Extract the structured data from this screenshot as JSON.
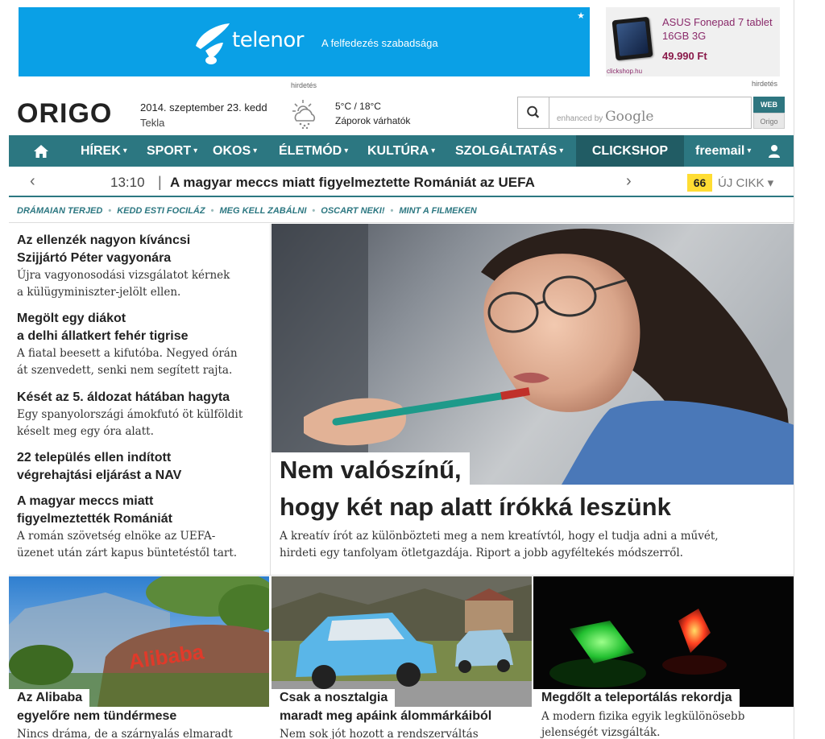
{
  "ads": {
    "banner_brand": "telenor",
    "banner_slogan": "A felfedezés szabadsága",
    "banner_star": "★",
    "ad_label": "hirdetés",
    "side_product": "ASUS Fonepad 7 tablet 16GB 3G",
    "side_price": "49.990 Ft",
    "side_shop": "clickshop.hu",
    "side_label": "hirdetés",
    "brand_color": "#0aa0e6"
  },
  "header": {
    "logo": "ORIGO",
    "date": "2014. szeptember 23. kedd",
    "nameday": "Tekla",
    "temperature": "5°C / 18°C",
    "forecast": "Záporok várhatók",
    "weather_icon": "cloud-rain-sun-icon"
  },
  "search": {
    "enhanced_by": "enhanced by",
    "google": "Google",
    "web_button": "WEB",
    "origo_button": "Origo"
  },
  "nav": {
    "color": "#2c7781",
    "items": [
      {
        "label": "HÍREK"
      },
      {
        "label": "SPORT"
      },
      {
        "label": "OKOS"
      },
      {
        "label": "ÉLETMÓD"
      },
      {
        "label": "KULTÚRA"
      },
      {
        "label": "SZOLGÁLTATÁS"
      }
    ],
    "clickshop": "CLICKSHOP",
    "freemail": "freemail",
    "caret": "▾"
  },
  "ticker": {
    "prev": "‹",
    "next": "›",
    "time": "13:10",
    "sep": "|",
    "title": "A magyar meccs miatt figyelmeztette Romániát az UEFA",
    "count": "66",
    "new_label": "ÚJ CIKK ▾"
  },
  "tags": [
    "DRÁMAIAN TERJED",
    "KEDD ESTI FOCILÁZ",
    "MEG KELL ZABÁLNI",
    "OSCART NEKI!",
    "MINT A FILMEKEN"
  ],
  "tag_dot": "•",
  "left_stories": [
    {
      "h1": "Az ellenzék nagyon kíváncsi",
      "h2": "Szijjártó Péter vagyonára",
      "l1": "Újra vagyonosodási vizsgálatot kérnek",
      "l2": "a külügyminiszter-jelölt ellen."
    },
    {
      "h1": "Megölt egy diákot",
      "h2": "a delhi állatkert fehér tigrise",
      "l1": "A fiatal beesett a kifutóba. Negyed órán",
      "l2": "át szenvedett, senki nem segített rajta."
    },
    {
      "h1": "Kését az 5. áldozat hátában hagyta",
      "h2": "",
      "l1": "Egy spanyolországi ámokfutó öt külföldit",
      "l2": "késelt meg egy óra alatt."
    },
    {
      "h1": "22 település ellen indított",
      "h2": "végrehajtási eljárást a NAV",
      "l1": "",
      "l2": ""
    },
    {
      "h1": "A magyar meccs miatt",
      "h2": "figyelmeztették Romániát",
      "l1": "A román szövetség elnöke az UEFA-",
      "l2": "üzenet után zárt kapus büntetéstől tart."
    }
  ],
  "main": {
    "title_line1": "Nem valószínű,",
    "title_line2": "hogy két nap alatt írókká leszünk",
    "lead_line1": "A kreatív írót az különbözteti meg a nem kreatívtól, hogy el tudja adni a művét,",
    "lead_line2": "hirdeti egy tanfolyam ötletgazdája. Riport a jobb agyféltekés módszerről."
  },
  "tiles": [
    {
      "cap1": "Az Alibaba",
      "cap2": "egyelőre nem tündérmese",
      "lead": "Nincs dráma, de a szárnyalás elmaradt",
      "sign": "Alibaba"
    },
    {
      "cap1": "Csak a nosztalgia",
      "cap2": "maradt meg apáink álommárkáiból",
      "lead": "Nem sok jót hozott a rendszerváltás"
    },
    {
      "cap1": "Megdőlt a teleportálás rekordja",
      "cap2": "",
      "lead": "A modern fizika egyik legkülönösebb",
      "lead2": "jelenségét vizsgálták."
    }
  ]
}
